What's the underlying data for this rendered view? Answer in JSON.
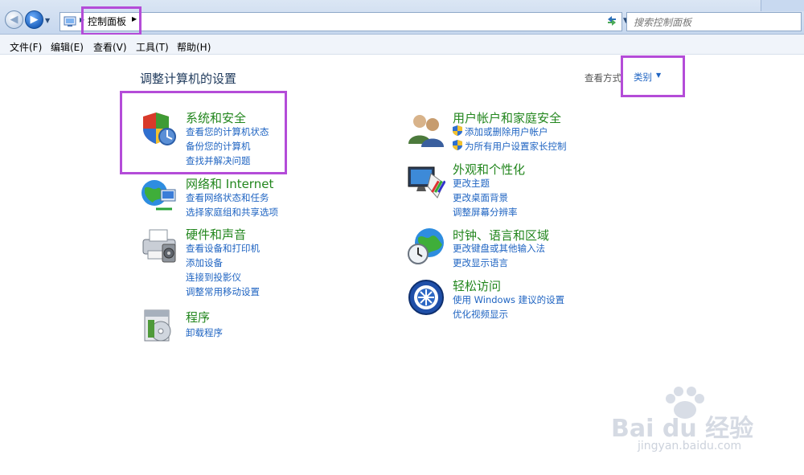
{
  "nav": {
    "breadcrumb": "控制面板",
    "search_placeholder": "搜索控制面板"
  },
  "menu": [
    "文件(F)",
    "编辑(E)",
    "查看(V)",
    "工具(T)",
    "帮助(H)"
  ],
  "page": {
    "title": "调整计算机的设置",
    "view_by_label": "查看方式",
    "view_by_value": "类别"
  },
  "categories": [
    {
      "title": "系统和安全",
      "links": [
        "查看您的计算机状态",
        "备份您的计算机",
        "查找并解决问题"
      ],
      "icon": "shield-icon"
    },
    {
      "title": "网络和 Internet",
      "links": [
        "查看网络状态和任务",
        "选择家庭组和共享选项"
      ],
      "icon": "network-globe-icon"
    },
    {
      "title": "硬件和声音",
      "links": [
        "查看设备和打印机",
        "添加设备",
        "连接到投影仪",
        "调整常用移动设置"
      ],
      "icon": "printer-icon"
    },
    {
      "title": "程序",
      "links": [
        "卸载程序"
      ],
      "icon": "programs-icon"
    },
    {
      "title": "用户帐户和家庭安全",
      "links": [
        "添加或删除用户帐户",
        "为所有用户设置家长控制"
      ],
      "icon": "users-icon"
    },
    {
      "title": "外观和个性化",
      "links": [
        "更改主题",
        "更改桌面背景",
        "调整屏幕分辨率"
      ],
      "icon": "monitor-palette-icon"
    },
    {
      "title": "时钟、语言和区域",
      "links": [
        "更改键盘或其他输入法",
        "更改显示语言"
      ],
      "icon": "clock-globe-icon"
    },
    {
      "title": "轻松访问",
      "links": [
        "使用 Windows 建议的设置",
        "优化视频显示"
      ],
      "icon": "ease-of-access-icon"
    }
  ],
  "watermark": {
    "brand": "Bai du 经验",
    "url": "jingyan.baidu.com"
  },
  "colors": {
    "highlight": "#b44cd8",
    "category_title": "#22861d",
    "link": "#1f64c2"
  }
}
